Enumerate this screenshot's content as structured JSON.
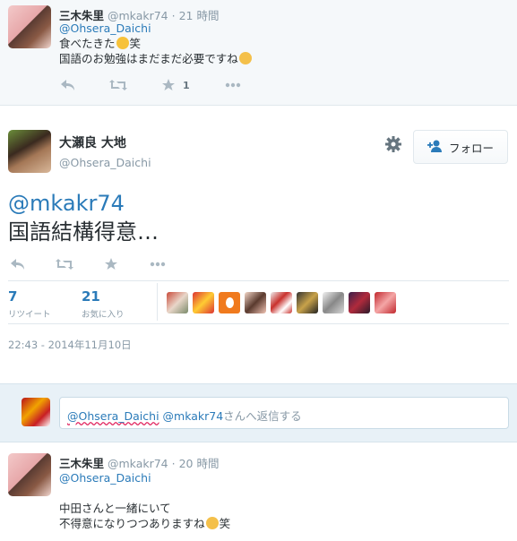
{
  "tweet1": {
    "fullname": "三木朱里",
    "handle": "@mkakr74",
    "time": "21 時間",
    "mention": "@Ohsera_Daichi",
    "line1_a": "食べたきた",
    "line1_b": "笑",
    "line2": "国語のお勉強はまだまだ必要ですね",
    "fav_count": "1"
  },
  "main": {
    "fullname": "大瀬良 大地",
    "handle": "@Ohsera_Daichi",
    "follow_label": "フォロー",
    "mention": "@mkakr74",
    "text": "国語結構得意…",
    "retweets_count": "7",
    "retweets_label": "リツイート",
    "favorites_count": "21",
    "favorites_label": "お気に入り",
    "timestamp": "22:43 - 2014年11月10日"
  },
  "reply": {
    "mention1": "@Ohsera_Daichi",
    "mention2": "@mkakr74",
    "suffix": "さんへ返信する"
  },
  "tweet2": {
    "fullname": "三木朱里",
    "handle": "@mkakr74",
    "time": "20 時間",
    "mention": "@Ohsera_Daichi",
    "line1": "中田さんと一緒にいて",
    "line2_a": "不得意になりつつありますね",
    "line2_b": "笑"
  },
  "colors": {
    "link": "#2b7bb9",
    "muted": "#8899a6",
    "icon": "#aab8c2"
  },
  "icons": [
    "reply-icon",
    "retweet-icon",
    "favorite-icon",
    "more-icon",
    "gear-icon",
    "follow-person-icon"
  ]
}
